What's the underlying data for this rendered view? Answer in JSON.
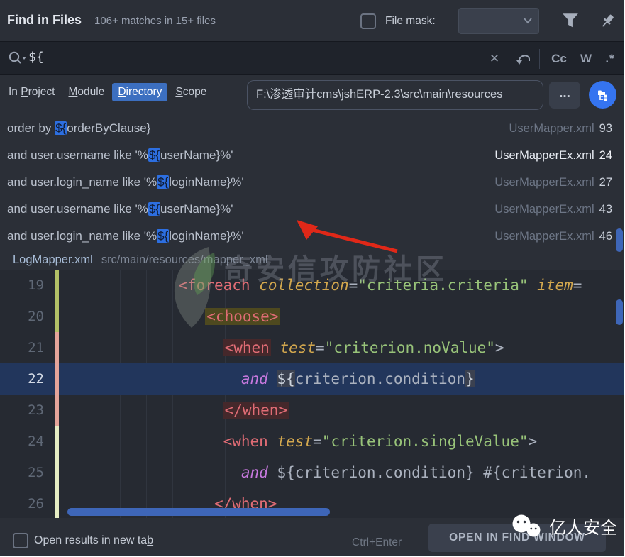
{
  "header": {
    "title": "Find in Files",
    "subtitle": "106+ matches in 15+ files",
    "file_mask_label": {
      "label": "File mask:",
      "u": 8
    },
    "file_mask_checked": false,
    "file_mask_value": ""
  },
  "search": {
    "query": "${",
    "clear_icon": "✕",
    "match_case": "Cc",
    "words": "W",
    "regex": ".*"
  },
  "scope": {
    "tabs": [
      {
        "label": "In Project",
        "u": 3,
        "active": false
      },
      {
        "label": "Module",
        "u": 0,
        "active": false
      },
      {
        "label": "Directory",
        "u": 0,
        "active": true
      },
      {
        "label": "Scope",
        "u": 0,
        "active": false
      }
    ],
    "path": "F:\\渗透审计cms\\jshERP-2.3\\src\\main\\resources",
    "browse": "..."
  },
  "results": {
    "rows": [
      {
        "pre": "order by ",
        "match": "${",
        "post": "orderByClause}",
        "file": "UserMapper.xml",
        "line": "93",
        "bright": false
      },
      {
        "pre": "and user.username like '%",
        "match": "${",
        "post": "userName}%'",
        "file": "UserMapperEx.xml",
        "line": "24",
        "bright": true
      },
      {
        "pre": "and user.login_name like '%",
        "match": "${",
        "post": "loginName}%'",
        "file": "UserMapperEx.xml",
        "line": "27",
        "bright": false
      },
      {
        "pre": "and user.username like '%",
        "match": "${",
        "post": "userName}%'",
        "file": "UserMapperEx.xml",
        "line": "43",
        "bright": false
      },
      {
        "pre": "and user.login_name like '%",
        "match": "${",
        "post": "loginName}%'",
        "file": "UserMapperEx.xml",
        "line": "46",
        "bright": false
      }
    ]
  },
  "group": {
    "file": "LogMapper.xml",
    "path": "src/main/resources/mapper_xml"
  },
  "editor": {
    "lines": [
      {
        "n": "19",
        "mark": "added",
        "selected": false,
        "segs": [
          [
            "             ",
            "ws"
          ],
          [
            "<foreach",
            "tag"
          ],
          [
            " ",
            "plain"
          ],
          [
            "collection",
            "attr"
          ],
          [
            "=",
            "plain"
          ],
          [
            "\"criteria.criteria\"",
            "str"
          ],
          [
            " ",
            "plain"
          ],
          [
            "item",
            "attr"
          ],
          [
            "=",
            "plain"
          ]
        ]
      },
      {
        "n": "20",
        "mark": "added",
        "selected": false,
        "segs": [
          [
            "                ",
            "ws"
          ],
          [
            "<choose>",
            "tag olive"
          ]
        ]
      },
      {
        "n": "21",
        "mark": "modified",
        "selected": false,
        "segs": [
          [
            "                  ",
            "ws"
          ],
          [
            "<when",
            "tag redbg"
          ],
          [
            " ",
            "plain"
          ],
          [
            "test",
            "attr"
          ],
          [
            "=",
            "plain"
          ],
          [
            "\"criterion.noValue\"",
            "str"
          ],
          [
            ">",
            "plain"
          ]
        ]
      },
      {
        "n": "22",
        "mark": "modified",
        "selected": true,
        "segs": [
          [
            "                    ",
            "ws"
          ],
          [
            "and",
            "kw wavy"
          ],
          [
            " ",
            "plain wavy"
          ],
          [
            "${",
            "brace"
          ],
          [
            "criterion.condition",
            "plain wavy"
          ],
          [
            "}",
            "brace"
          ]
        ]
      },
      {
        "n": "23",
        "mark": "modified",
        "selected": false,
        "segs": [
          [
            "                  ",
            "ws"
          ],
          [
            "</when>",
            "tag redbg"
          ]
        ]
      },
      {
        "n": "24",
        "mark": "pale",
        "selected": false,
        "segs": [
          [
            "                  ",
            "ws"
          ],
          [
            "<when",
            "tag"
          ],
          [
            " ",
            "plain"
          ],
          [
            "test",
            "attr"
          ],
          [
            "=",
            "plain"
          ],
          [
            "\"criterion.singleValue\"",
            "str"
          ],
          [
            ">",
            "plain"
          ]
        ]
      },
      {
        "n": "25",
        "mark": "pale",
        "selected": false,
        "segs": [
          [
            "                    ",
            "ws"
          ],
          [
            "and",
            "kw wavy"
          ],
          [
            " ",
            "plain wavy"
          ],
          [
            "${criterion.condition}",
            "plain wavy"
          ],
          [
            " ",
            "plain wavy"
          ],
          [
            "#{criterion.",
            "plain wavy"
          ]
        ]
      },
      {
        "n": "26",
        "mark": "pale",
        "selected": false,
        "segs": [
          [
            "                 ",
            "ws"
          ],
          [
            "</when>",
            "tag"
          ]
        ]
      }
    ]
  },
  "footer": {
    "open_label": {
      "label": "Open results in new tab",
      "u": 22
    },
    "open_checked": false,
    "shortcut": "Ctrl+Enter",
    "button": "OPEN IN FIND WINDOW"
  },
  "watermarks": {
    "center": "奇安信攻防社区",
    "bottom": "亿人安全"
  },
  "colors": {
    "accent": "#3574f0",
    "tab-active": "#3c6fc0",
    "match-highlight": "#2d6fe1",
    "selected-line": "#22365c",
    "scrollbar": "#3e66b8",
    "vcs-added": "#b3c167",
    "vcs-modified": "#e5a49a",
    "vcs-pale": "#e6edc4",
    "arrow": "#e02818"
  }
}
